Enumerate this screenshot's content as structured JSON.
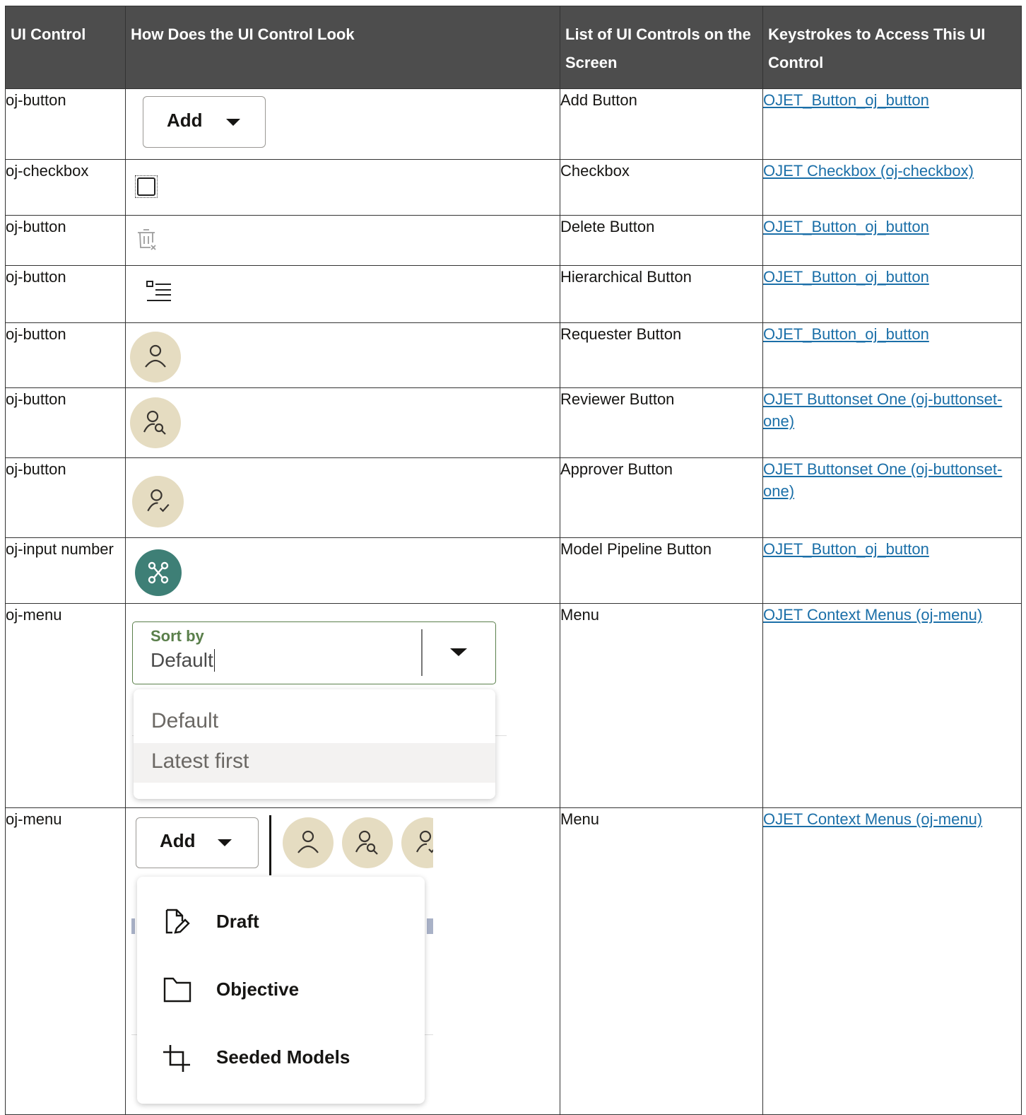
{
  "table": {
    "headers": [
      "UI Control",
      "How Does the UI Control Look",
      "List of UI Controls on the Screen",
      "Keystrokes to Access This UI Control"
    ],
    "rows": [
      {
        "control": "oj-button",
        "list": "Add Button",
        "link": "OJET_Button_oj_button",
        "visual": {
          "add_label": "Add"
        }
      },
      {
        "control": "oj-checkbox",
        "list": "Checkbox",
        "link": "OJET Checkbox (oj-checkbox)"
      },
      {
        "control": "oj-button",
        "list": "Delete Button",
        "link": "OJET_Button_oj_button"
      },
      {
        "control": "oj-button",
        "list": "Hierarchical Button",
        "link": "OJET_Button_oj_button"
      },
      {
        "control": "oj-button",
        "list": "Requester Button",
        "link": "OJET_Button_oj_button"
      },
      {
        "control": "oj-button",
        "list": "Reviewer Button",
        "link": "OJET Buttonset One (oj-buttonset-one)"
      },
      {
        "control": "oj-button",
        "list": "Approver Button",
        "link": "OJET Buttonset One (oj-buttonset-one)"
      },
      {
        "control": "oj-input number",
        "list": "Model Pipeline Button",
        "link": "OJET_Button_oj_button"
      },
      {
        "control": "oj-menu",
        "list": "Menu",
        "link": "OJET Context Menus (oj-menu)",
        "visual": {
          "sort_label": "Sort by",
          "sort_value": "Default",
          "options": [
            "Default",
            "Latest first"
          ]
        }
      },
      {
        "control": "oj-menu",
        "list": "Menu",
        "link": "OJET Context Menus (oj-menu)",
        "visual": {
          "add_label": "Add",
          "items": [
            "Draft",
            "Objective",
            "Seeded Models"
          ]
        }
      }
    ]
  },
  "colors": {
    "header_bg": "#4d4d4d",
    "link": "#1b6fa8",
    "avatar_bg": "#e5dcc1",
    "pipeline_bg": "#3e7f76",
    "sort_border": "#5a7f4b"
  }
}
